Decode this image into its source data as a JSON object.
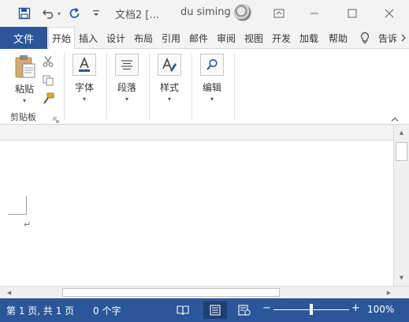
{
  "titlebar": {
    "doc_title": "文档2 [...",
    "user_name": "du siming",
    "colors": {
      "background": "#f3f3f3",
      "icon": "#2b579a"
    },
    "icons": [
      "save-icon",
      "undo-icon",
      "redo-icon",
      "customize-qat-icon",
      "ribbon-display-icon",
      "minimize-icon",
      "maximize-icon",
      "close-icon"
    ]
  },
  "tabs": {
    "file": "文件",
    "items": [
      "开始",
      "插入",
      "设计",
      "布局",
      "引用",
      "邮件",
      "审阅",
      "视图",
      "开发",
      "加载",
      "帮助",
      "告诉"
    ],
    "active_index": 0,
    "file_color": "#2b579a"
  },
  "ribbon": {
    "paste_label": "粘贴",
    "clipboard_group": "剪贴板",
    "font_label": "字体",
    "paragraph_label": "段落",
    "styles_label": "样式",
    "editing_label": "编辑"
  },
  "document": {
    "paragraph_mark": "↵"
  },
  "status": {
    "page": "第 1 页, 共 1 页",
    "words": "0 个字",
    "zoom": "100%",
    "zoom_minus": "−",
    "zoom_plus": "+",
    "zoom_level": 1.0,
    "color": "#2b579a"
  }
}
